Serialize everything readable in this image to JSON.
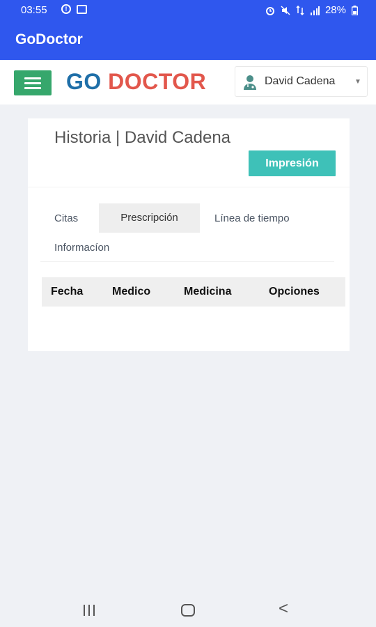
{
  "statusbar": {
    "time": "03:55",
    "battery": "28%",
    "left_icons": [
      "alert-circle-icon",
      "image-icon"
    ],
    "right_icons": [
      "alarm-icon",
      "mute-icon",
      "data-arrows-icon",
      "signal-icon",
      "battery-icon"
    ]
  },
  "appbar": {
    "title": "GoDoctor"
  },
  "navbar": {
    "menu_icon": "hamburger-icon",
    "logo_go": "GO",
    "logo_doctor": "DOCTOR",
    "user_name": "David Cadena",
    "user_icon": "doctor-avatar-icon"
  },
  "card": {
    "title": "Historia | David Cadena",
    "print_button": "Impresión",
    "tabs": [
      {
        "label": "Citas",
        "active": false
      },
      {
        "label": "Prescripción",
        "active": true
      },
      {
        "label": "Línea de tiempo",
        "active": false
      },
      {
        "label": "Informacíon",
        "active": false
      }
    ],
    "table": {
      "headers": [
        "Fecha",
        "Medico",
        "Medicina",
        "Opciones"
      ],
      "rows": []
    }
  },
  "colors": {
    "primary": "#2f57ee",
    "menu_button": "#36a76c",
    "logo_go": "#1f6fa8",
    "logo_doctor": "#e2574c",
    "print_button": "#3ec1b8",
    "background": "#eff1f5"
  }
}
